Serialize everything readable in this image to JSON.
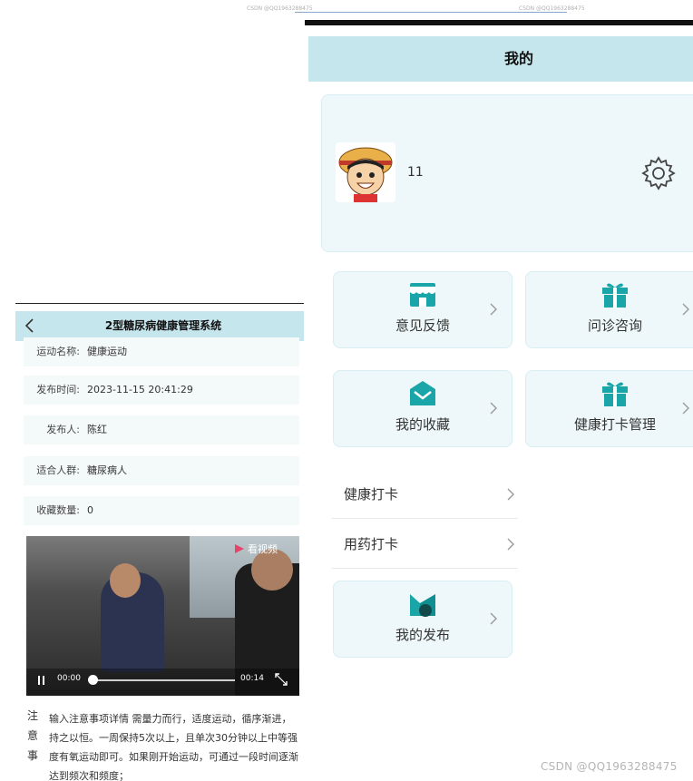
{
  "top_captions": [
    "CSDN @QQ1963288475",
    "CSDN @QQ1963288475"
  ],
  "left": {
    "title": "2型糖尿病健康管理系统",
    "rows": [
      {
        "label": "运动名称:",
        "value": "健康运动"
      },
      {
        "label": "发布时间:",
        "value": "2023-11-15 20:41:29"
      },
      {
        "label": "发布人:",
        "value": "陈红"
      },
      {
        "label": "适合人群:",
        "value": "糖尿病人"
      },
      {
        "label": "收藏数量:",
        "value": "0"
      }
    ],
    "video": {
      "badge": "看视频",
      "current_time": "00:00",
      "duration": "00:14",
      "progress": 0
    },
    "note": {
      "key": "注意事",
      "text": "输入注意事项详情 需量力而行，适度运动，循序渐进，持之以恒。一周保持5次以上，且单次30分钟以上中等强度有氧运动即可。如果刚开始运动，可通过一段时间逐渐达到频次和频度；"
    }
  },
  "right": {
    "title": "我的",
    "username": "11",
    "cards": [
      {
        "label": "意见反馈",
        "icon": "shop-icon"
      },
      {
        "label": "问诊咨询",
        "icon": "gift-icon"
      },
      {
        "label": "我的收藏",
        "icon": "envelope-icon"
      },
      {
        "label": "健康打卡管理",
        "icon": "gift-icon"
      },
      {
        "label": "我的发布",
        "icon": "publish-icon"
      }
    ],
    "list": [
      {
        "label": "健康打卡"
      },
      {
        "label": "用药打卡"
      }
    ]
  },
  "watermark": "CSDN @QQ1963288475",
  "colors": {
    "accent": "#1aa6a8",
    "header_bg": "#c6e6ee",
    "card_bg": "#eef8fa"
  }
}
